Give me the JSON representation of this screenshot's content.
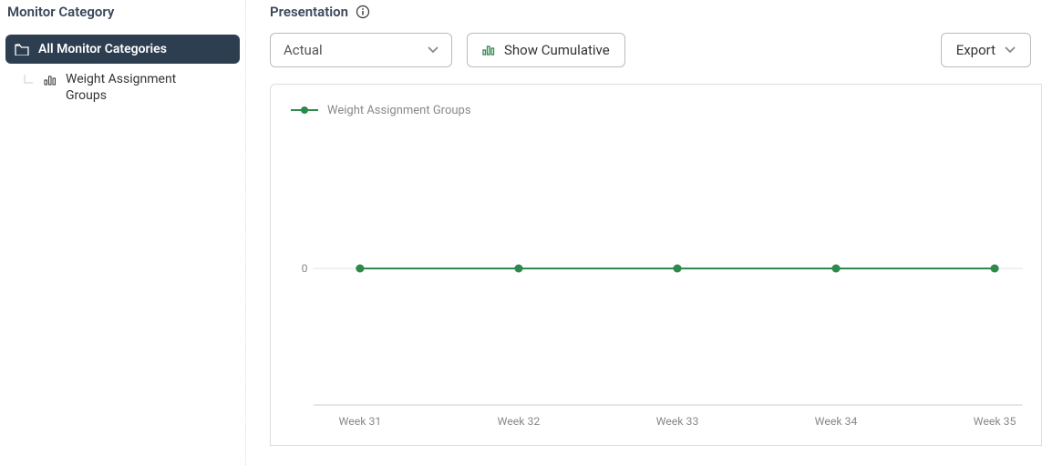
{
  "sidebar": {
    "header": "Monitor Category",
    "root": {
      "label": "All Monitor Categories"
    },
    "children": [
      {
        "label": "Weight Assignment Groups"
      }
    ]
  },
  "main": {
    "header": "Presentation",
    "mode_select": {
      "value": "Actual"
    },
    "cumulative_button": "Show Cumulative",
    "export_button": "Export"
  },
  "chart_data": {
    "type": "line",
    "title": "",
    "xlabel": "",
    "ylabel": "",
    "ylim": [
      -1,
      1
    ],
    "yticks": [
      0
    ],
    "categories": [
      "Week 31",
      "Week 32",
      "Week 33",
      "Week 34",
      "Week 35"
    ],
    "series": [
      {
        "name": "Weight Assignment Groups",
        "values": [
          0,
          0,
          0,
          0,
          0
        ],
        "color": "#2d8a4b"
      }
    ]
  }
}
